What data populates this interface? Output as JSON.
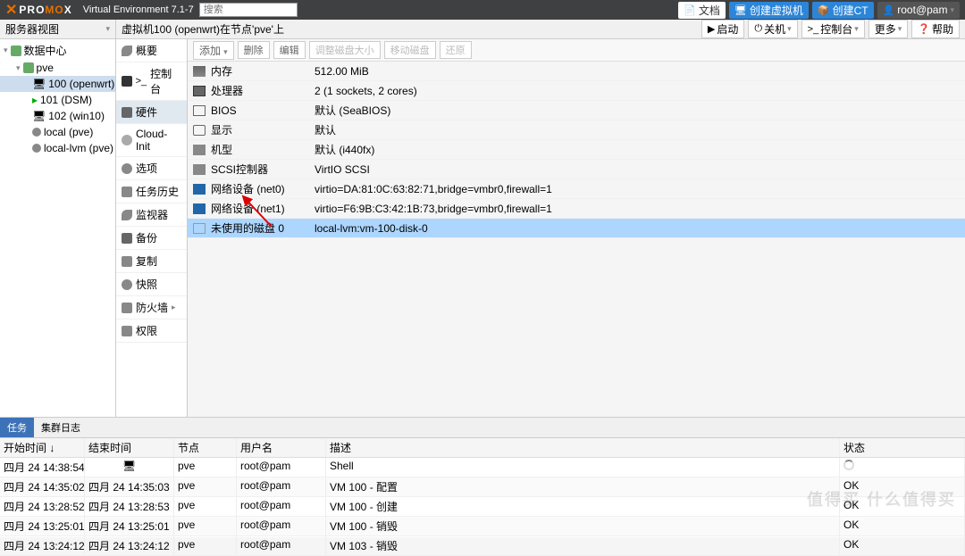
{
  "header": {
    "product1": "PRO",
    "product2": "MO",
    "product3": "X",
    "version": "Virtual Environment 7.1-7",
    "search_placeholder": "搜索",
    "docs": "文档",
    "create_vm": "创建虚拟机",
    "create_ct": "创建CT",
    "user": "root@pam"
  },
  "viewsel": "服务器视图",
  "tree": {
    "dc": "数据中心",
    "pve": "pve",
    "vm100": "100 (openwrt)",
    "vm101": "101 (DSM)",
    "vm102": "102 (win10)",
    "local": "local (pve)",
    "locallvm": "local-lvm (pve)"
  },
  "crumb": "虚拟机100 (openwrt)在节点'pve'上",
  "actions": {
    "start": "启动",
    "shutdown": "关机",
    "console": "控制台",
    "more": "更多",
    "help": "帮助"
  },
  "side": {
    "summary": "概要",
    "console": "控制台",
    "hardware": "硬件",
    "cloudinit": "Cloud-Init",
    "options": "选项",
    "tasks": "任务历史",
    "monitor": "监视器",
    "backup": "备份",
    "replication": "复制",
    "snapshots": "快照",
    "firewall": "防火墙",
    "perms": "权限"
  },
  "toolbar": {
    "add": "添加",
    "remove": "删除",
    "edit": "编辑",
    "resize": "调整磁盘大小",
    "move": "移动磁盘",
    "revert": "还原"
  },
  "hw": [
    {
      "k": "内存",
      "v": "512.00 MiB",
      "ic": "ic-mem"
    },
    {
      "k": "处理器",
      "v": "2 (1 sockets, 2 cores)",
      "ic": "ic-cpu"
    },
    {
      "k": "BIOS",
      "v": "默认 (SeaBIOS)",
      "ic": "ic-bios"
    },
    {
      "k": "显示",
      "v": "默认",
      "ic": "ic-disp"
    },
    {
      "k": "机型",
      "v": "默认 (i440fx)",
      "ic": "ic-pc"
    },
    {
      "k": "SCSI控制器",
      "v": "VirtIO SCSI",
      "ic": "ic-scsi"
    },
    {
      "k": "网络设备 (net0)",
      "v": "virtio=DA:81:0C:63:82:71,bridge=vmbr0,firewall=1",
      "ic": "ic-net"
    },
    {
      "k": "网络设备 (net1)",
      "v": "virtio=F6:9B:C3:42:1B:73,bridge=vmbr0,firewall=1",
      "ic": "ic-net"
    },
    {
      "k": "未使用的磁盘 0",
      "v": "local-lvm:vm-100-disk-0",
      "ic": "ic-unk",
      "sel": true
    }
  ],
  "tabs": {
    "tasks": "任务",
    "cluster": "集群日志"
  },
  "loghead": {
    "start": "开始时间 ↓",
    "end": "结束时间",
    "node": "节点",
    "user": "用户名",
    "desc": "描述",
    "stat": "状态"
  },
  "logs": [
    {
      "start": "四月 24 14:38:54",
      "end": "",
      "node": "pve",
      "user": "root@pam",
      "desc": "Shell",
      "stat": "spinner"
    },
    {
      "start": "四月 24 14:35:02",
      "end": "四月 24 14:35:03",
      "node": "pve",
      "user": "root@pam",
      "desc": "VM 100 - 配置",
      "stat": "OK"
    },
    {
      "start": "四月 24 13:28:52",
      "end": "四月 24 13:28:53",
      "node": "pve",
      "user": "root@pam",
      "desc": "VM 100 - 创建",
      "stat": "OK"
    },
    {
      "start": "四月 24 13:25:01",
      "end": "四月 24 13:25:01",
      "node": "pve",
      "user": "root@pam",
      "desc": "VM 100 - 销毁",
      "stat": "OK"
    },
    {
      "start": "四月 24 13:24:12",
      "end": "四月 24 13:24:12",
      "node": "pve",
      "user": "root@pam",
      "desc": "VM 103 - 销毁",
      "stat": "OK"
    }
  ],
  "watermark": "值得买 什么值得买"
}
